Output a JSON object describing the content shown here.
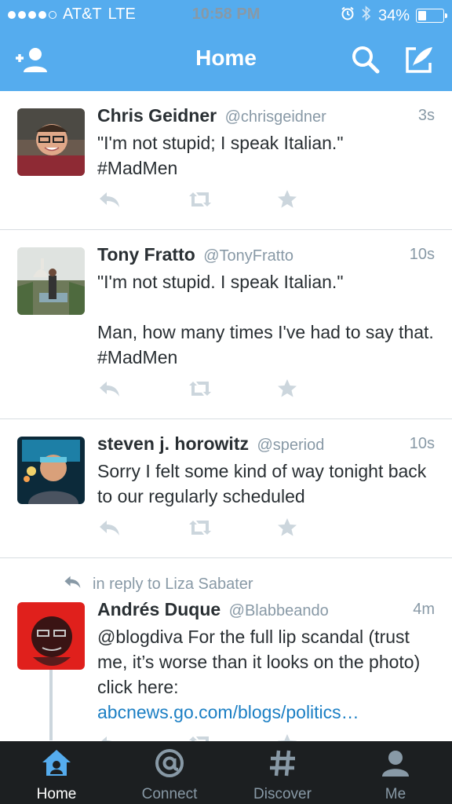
{
  "status_bar": {
    "carrier": "AT&T",
    "network": "LTE",
    "time": "10:58 PM",
    "battery": "34%",
    "battery_level": 0.34
  },
  "nav": {
    "title": "Home",
    "left_icon": "add-user-icon",
    "right_icons": [
      "search-icon",
      "compose-icon"
    ]
  },
  "tweets": [
    {
      "name": "Chris Geidner",
      "handle": "@chrisgeidner",
      "time": "3s",
      "text": "\"I'm not stupid; I speak Italian.\"\n#MadMen"
    },
    {
      "name": "Tony Fratto",
      "handle": "@TonyFratto",
      "time": "10s",
      "text": "\"I'm not stupid.  I speak Italian.\"\n\nMan, how many times I've had to say that.  #MadMen"
    },
    {
      "name": "steven j. horowitz",
      "handle": "@speriod",
      "time": "10s",
      "text": "Sorry I felt some kind of way tonight back to our regularly scheduled"
    },
    {
      "reply_context": "in reply to Liza Sabater",
      "name": "Andrés Duque",
      "handle": "@Blabbeando",
      "time": "4m",
      "text": "@blogdiva For the full lip scandal (trust me, it’s worse than it looks on the photo) click here:",
      "link": "abcnews.go.com/blogs/politics…"
    }
  ],
  "tabs": [
    {
      "label": "Home",
      "icon": "home-icon",
      "active": true
    },
    {
      "label": "Connect",
      "icon": "at-sign-icon",
      "active": false
    },
    {
      "label": "Discover",
      "icon": "hashtag-icon",
      "active": false
    },
    {
      "label": "Me",
      "icon": "person-icon",
      "active": false
    }
  ],
  "colors": {
    "brand": "#55acee",
    "tab_bar": "#1c1f21",
    "action_icon": "#ccd6dd",
    "secondary_text": "#8899a6",
    "link": "#1b7fc4"
  }
}
